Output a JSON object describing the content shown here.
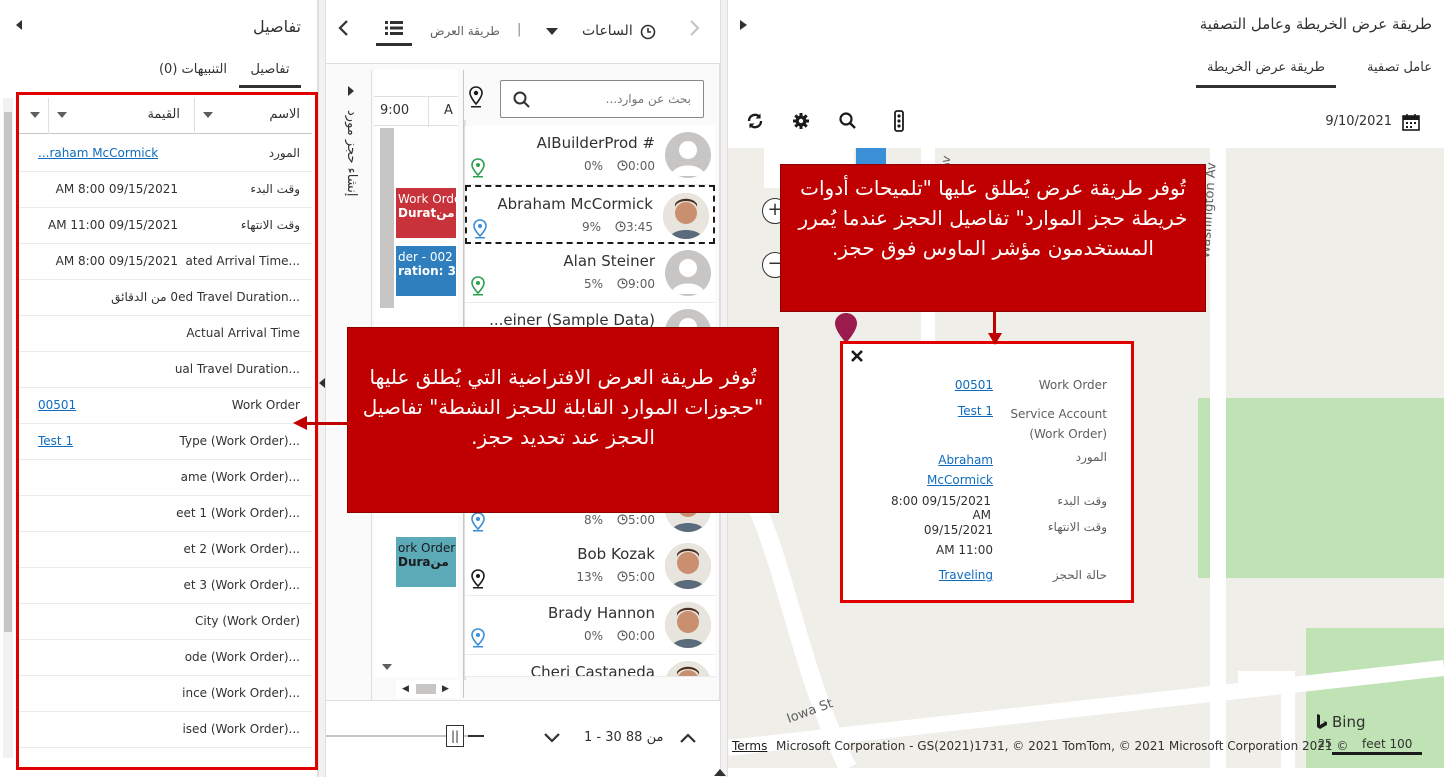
{
  "details_pane": {
    "title": "تفاصيل",
    "tabs": [
      {
        "label": "تفاصيل"
      },
      {
        "label": "التنبيهات (0)"
      }
    ],
    "columns": {
      "name": "الاسم",
      "value": "القيمة"
    },
    "rows": [
      {
        "label": "المورد",
        "value": "Abraham McCormick",
        "value_display": "...raham McCormick",
        "link": true
      },
      {
        "label": "وقت البدء",
        "value": "09/15/2021 8:00 AM"
      },
      {
        "label": "وقت الانتهاء",
        "value": "09/15/2021 11:00 AM"
      },
      {
        "label": "...ated Arrival Time",
        "value": "09/15/2021 8:00 AM"
      },
      {
        "label": "...ed Travel Duration",
        "value": "0 من الدقائق"
      },
      {
        "label": "Actual Arrival Time",
        "value": ""
      },
      {
        "label": "...ual Travel Duration",
        "value": ""
      },
      {
        "label": "Work Order",
        "value": "00501",
        "link": true
      },
      {
        "label": "...Type (Work Order)",
        "value": "Test 1",
        "link": true
      },
      {
        "label": "...ame (Work Order)",
        "value": ""
      },
      {
        "label": "...eet 1 (Work Order)",
        "value": ""
      },
      {
        "label": "...et 2 (Work Order)",
        "value": ""
      },
      {
        "label": "...et 3 (Work Order)",
        "value": ""
      },
      {
        "label": "City (Work Order)",
        "value": ""
      },
      {
        "label": "...ode (Work Order)",
        "value": ""
      },
      {
        "label": "...ince (Work Order)",
        "value": ""
      },
      {
        "label": "...ised (Work Order)",
        "value": ""
      }
    ]
  },
  "schedule_pane": {
    "hours_label": "الساعات",
    "view_label": "طريقة العرض",
    "search_placeholder": "بحث عن موارد...",
    "side_tab_label": "إنشاء حجز مورد",
    "timeline_time": "9:00",
    "timeline_letter": "A",
    "bookings": [
      {
        "line1": "Work Order",
        "line2": "Duratمن"
      },
      {
        "line1": "der - 002",
        "line2": "ration: 3"
      },
      {
        "line1": "ork Order",
        "line2": "Duraمن"
      }
    ],
    "resources": [
      {
        "name": "AIBuilderProd #",
        "percent": "0%",
        "time": "0:00",
        "pin": "green",
        "avatar": "default"
      },
      {
        "name": "Abraham McCormick",
        "percent": "9%",
        "time": "3:45",
        "pin": "blue",
        "avatar": "photo",
        "selected": true
      },
      {
        "name": "Alan Steiner",
        "percent": "5%",
        "time": "9:00",
        "pin": "green",
        "avatar": "default"
      },
      {
        "name": "...einer (Sample Data)",
        "percent": "",
        "time": "",
        "pin": "",
        "avatar": "default"
      },
      {
        "name": "",
        "percent": "8%",
        "time": "5:00",
        "pin": "blue",
        "avatar": "photo"
      },
      {
        "name": "Bob Kozak",
        "percent": "13%",
        "time": "5:00",
        "pin": "dark",
        "avatar": "photo"
      },
      {
        "name": "Brady Hannon",
        "percent": "0%",
        "time": "0:00",
        "pin": "blue",
        "avatar": "photo"
      },
      {
        "name": "Cheri Castaneda",
        "percent": "",
        "time": "",
        "pin": "",
        "avatar": "photo"
      }
    ],
    "pagination": "1 - 30 من 88"
  },
  "map_pane": {
    "title": "طريقة عرض الخريطة وعامل التصفية",
    "tabs": [
      {
        "label": "طريقة عرض الخريطة"
      },
      {
        "label": "عامل تصفية"
      }
    ],
    "date": "9/10/2021",
    "streets": [
      "Washington Av",
      "Iowa St",
      "Av"
    ],
    "bing_label": "Bing",
    "scale_label": "feet 100",
    "scale_label2": "25",
    "terms_label": "Terms",
    "copyright": "Microsoft Corporation - GS(2021)1731, © 2021 TomTom, © 2021 Microsoft Corporation 2021 ©",
    "popup": {
      "rows": [
        {
          "label": "Work Order",
          "value": "00501",
          "link": true
        },
        {
          "label": "Service Account (Work Order)",
          "value": "Test 1",
          "link": true
        },
        {
          "label": "المورد",
          "value": "Abraham McCormick",
          "link": true
        },
        {
          "label": "وقت البدء",
          "value": "09/15/2021 8:00 AM"
        },
        {
          "label": "وقت الانتهاء",
          "value": "09/15/2021 11:00 AM"
        },
        {
          "label": "حالة الحجز",
          "value": "Traveling",
          "link": true
        }
      ]
    }
  },
  "callouts": {
    "map": "تُوفر طريقة عرض يُطلق عليها \"تلميحات أدوات خريطة حجز الموارد\" تفاصيل الحجز عندما يُمرر المستخدمون مؤشر الماوس فوق حجز.",
    "details": "تُوفر طريقة العرض الافتراضية التي يُطلق عليها \"حجوزات الموارد القابلة للحجز النشطة\" تفاصيل الحجز عند تحديد حجز."
  },
  "colors": {
    "callout": "#c00000",
    "link": "#0f6cbd",
    "green_pin": "#2e9e4f",
    "blue_pin": "#3a8fd6",
    "booking_red": "#c8323a",
    "booking_blue": "#2f7fbf",
    "booking_teal": "#5ca9b7"
  }
}
